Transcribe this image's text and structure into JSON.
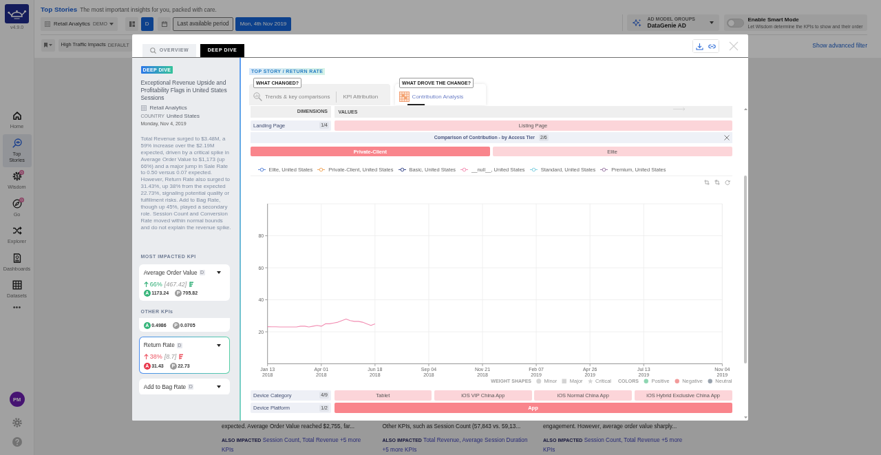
{
  "app": {
    "version": "v4.9.0"
  },
  "sidebar": {
    "items": [
      {
        "label": "Home",
        "selected": false,
        "badge": false
      },
      {
        "label": "Top Stories",
        "selected": true,
        "badge": false
      },
      {
        "label": "Wisdom",
        "selected": false,
        "badge": true
      },
      {
        "label": "Go",
        "selected": false,
        "badge": true
      },
      {
        "label": "Explorer",
        "selected": false,
        "badge": false
      },
      {
        "label": "Dashboards",
        "selected": false,
        "badge": false
      },
      {
        "label": "Datasets",
        "selected": false,
        "badge": false
      }
    ],
    "more": "•••",
    "avatar": "PM"
  },
  "header": {
    "title": "Top Stories",
    "subtitle": "The most important insights for you, packed with care.",
    "dataset": "Retail Analytics",
    "dataset_tag": "DEMO",
    "granularity": "D",
    "period": "Last available period",
    "date": "Mon, 4th Nov 2019",
    "model_group_caption": "AD MODEL GROUPS",
    "model_group": "DataGenie AD",
    "smart_mode": {
      "label": "Enable Smart Mode",
      "hint": "Let Wisdom determine the KPIs to show and their order",
      "on": false
    },
    "view": "High Traffic Impacts",
    "view_tag": "DEFAULT",
    "advanced_filter": "Show advanced filter"
  },
  "story_cards": [
    {
      "text": "expected. Average Order Value reached $2,755, far...",
      "also_label": "ALSO IMPACTED",
      "also": "Session Count, Total Revenue +5 more KPIs"
    },
    {
      "text": "Other KPIs, such as Session Count (57,843 vs. 59,13...",
      "also_label": "ALSO IMPACTED",
      "also": "Total Revenue, Average Session Duration +5 more KPIs"
    },
    {
      "text": "engagement. However, average order value sharply...",
      "also_label": "ALSO IMPACTED",
      "also": "Session Count, Total Revenue +5 more KPIs"
    }
  ],
  "modal": {
    "tabs": [
      {
        "label": "OVERVIEW",
        "selected": false
      },
      {
        "label": "DEEP DIVE",
        "selected": true
      }
    ],
    "story": {
      "badge": "DEEP DIVE",
      "title": "Exceptional Revenue Upside and Profitability Flags in United States Sessions",
      "dataset": "Retail Analytics",
      "country_label": "COUNTRY",
      "country": "United States",
      "date": "Monday, Nov 4, 2019",
      "summary": "Total Revenue surged to $3.48M, a 59% increase over the $2.19M expected, driven by a critical spike in Average Order Value to $1,173 (up 66%) and a major jump in Sale Rate to 0.50 versus 0.07 expected. However, Return Rate also surged to 31.43%, up 38% from the expected 22.73%, signaling potential quality or fulfillment risks. Add to Bag Rate, though up 45%, played a secondary role. Session Count and Conversion Rate moved within normal bounds and do not explain the revenue spike.",
      "most_impacted_label": "MOST IMPACTED KPI",
      "most_impacted": {
        "name": "Average Order Value",
        "tag": "D",
        "positive": true,
        "change": "66%",
        "delta": "[467.42]",
        "actual_letter": "A",
        "actual": "1173.24",
        "predicted_letter": "P",
        "predicted": "705.82",
        "selected": false
      },
      "other_label": "OTHER KPIs",
      "other_kpis": [
        {
          "positive": true,
          "actual_letter": "A",
          "actual": "0.4986",
          "predicted_letter": "P",
          "predicted": "0.0705",
          "selected": false
        },
        {
          "name": "Return Rate",
          "tag": "D",
          "positive": false,
          "change": "38%",
          "delta": "[8.7]",
          "actual_letter": "A",
          "actual": "31.43",
          "predicted_letter": "P",
          "predicted": "22.73",
          "selected": true
        },
        {
          "name": "Add to Bag Rate",
          "tag": "D",
          "selected": false
        }
      ]
    },
    "breadcrumb": "TOP STORY / RETURN RATE",
    "analysis_groups": [
      {
        "caption": "WHAT CHANGED?",
        "tabs": [
          {
            "label": "Trends & key comparisons",
            "selected": false
          },
          {
            "label": "KPI Attribution",
            "selected": false
          }
        ]
      },
      {
        "caption": "WHAT DROVE THE CHANGE?",
        "tabs": [
          {
            "label": "Contribution Analysis",
            "selected": true
          }
        ]
      }
    ],
    "contribution": {
      "dimensions_header": "DIMENSIONS",
      "values_header": "VALUES",
      "rows_above": [
        {
          "dimension": "Landing Page",
          "count": "1/4",
          "values": [
            {
              "label": "Listing Page",
              "selected": false
            }
          ]
        }
      ],
      "comparison": {
        "title": "Comparison of Contribution - by Access Tier",
        "count": "2/6",
        "values": [
          {
            "label": "Private-Client",
            "selected": true
          },
          {
            "label": "Elite",
            "selected": false
          }
        ]
      },
      "chart": {
        "chart_data": {
          "type": "line",
          "grid": true,
          "categories": [
            "Jan 13 2018",
            null,
            null,
            null,
            null,
            null,
            null,
            null,
            null,
            null,
            null,
            null,
            null,
            "Apr 01 2018",
            null,
            null,
            null,
            null,
            null,
            null,
            null,
            null,
            null,
            null,
            null,
            null,
            "Jun 18 2018",
            null,
            null,
            null,
            null,
            null,
            null,
            null,
            null,
            null,
            null,
            null,
            null,
            "Sep 04 2018",
            null,
            null,
            null,
            null,
            null,
            null,
            null,
            null,
            null,
            null,
            null,
            null,
            "Nov 21 2018",
            null,
            null,
            null,
            null,
            null,
            null,
            null,
            null,
            null,
            null,
            null,
            null,
            "Feb 07 2019",
            null,
            null,
            null,
            null,
            null,
            null,
            null,
            null,
            null,
            null,
            null,
            null,
            "Apr 26 2019",
            null,
            null,
            null,
            null,
            null,
            null,
            null,
            null,
            null,
            null,
            null,
            null,
            "Jul 13 2019",
            null,
            null,
            null,
            null,
            null,
            null,
            null,
            null,
            null,
            null,
            null,
            null,
            null,
            null,
            null,
            null,
            null,
            null,
            "Nov 04 2019"
          ],
          "ylim": [
            0,
            100
          ],
          "yticks": [
            20,
            40,
            60,
            80
          ],
          "series": [
            {
              "name": "Elite, United States",
              "color": "#5b86d9",
              "values": [
                null,
                null,
                null,
                null,
                null,
                null,
                null,
                null,
                null,
                null,
                null,
                null,
                null,
                null,
                null,
                null,
                null,
                null,
                null,
                null,
                null,
                null,
                null,
                null,
                null,
                null,
                null,
                null,
                null,
                null,
                null,
                null,
                null,
                null,
                null,
                null,
                null,
                null,
                null,
                null,
                null,
                null,
                null,
                null,
                null,
                null,
                null,
                null,
                null,
                null,
                null,
                null,
                null,
                null,
                null,
                null,
                null,
                null,
                null,
                null,
                null,
                null,
                null,
                null,
                null,
                null,
                null,
                null,
                null,
                null,
                null,
                null,
                null,
                null,
                null,
                null,
                null,
                null,
                null,
                null,
                null,
                null,
                null,
                null,
                null,
                null,
                null,
                null,
                null,
                null,
                null,
                null,
                null,
                null,
                null,
                null,
                null,
                null,
                null,
                null,
                null,
                null,
                null,
                null,
                null,
                null,
                null,
                null,
                null,
                null,
                null
              ]
            },
            {
              "name": "Private-Client, United States",
              "color": "#f0a55a",
              "values": [
                null,
                null,
                null,
                null,
                null,
                null,
                null,
                null,
                null,
                null,
                null,
                null,
                null,
                null,
                null,
                null,
                null,
                null,
                null,
                null,
                null,
                null,
                null,
                null,
                null,
                null,
                null,
                null,
                null,
                null,
                null,
                null,
                null,
                null,
                null,
                null,
                null,
                null,
                null,
                null,
                null,
                null,
                null,
                null,
                null,
                null,
                null,
                null,
                null,
                null,
                null,
                null,
                null,
                null,
                null,
                null,
                null,
                null,
                null,
                null,
                null,
                null,
                null,
                null,
                null,
                null,
                null,
                null,
                null,
                null,
                null,
                null,
                null,
                null,
                null,
                null,
                null,
                null,
                null,
                null,
                null,
                null,
                null,
                null,
                null,
                null,
                null,
                null,
                null,
                null,
                null,
                null,
                null,
                null,
                null,
                null,
                null,
                null,
                null,
                null,
                null,
                null,
                null,
                null,
                null,
                null,
                null,
                null,
                null,
                null,
                null
              ]
            },
            {
              "name": "Basic, United States",
              "color": "#3b4a8c",
              "values": [
                null,
                null,
                null,
                null,
                null,
                null,
                null,
                null,
                null,
                null,
                null,
                null,
                null,
                null,
                null,
                null,
                null,
                null,
                null,
                null,
                null,
                null,
                null,
                null,
                null,
                null,
                null,
                null,
                null,
                null,
                null,
                null,
                null,
                null,
                null,
                null,
                null,
                null,
                null,
                null,
                null,
                null,
                null,
                null,
                null,
                null,
                null,
                null,
                null,
                null,
                null,
                null,
                null,
                null,
                null,
                null,
                null,
                null,
                null,
                null,
                null,
                null,
                null,
                null,
                null,
                null,
                null,
                null,
                null,
                null,
                null,
                null,
                null,
                null,
                null,
                null,
                null,
                null,
                null,
                null,
                null,
                null,
                null,
                null,
                null,
                null,
                null,
                null,
                null,
                null,
                null,
                null,
                null,
                null,
                null,
                null,
                null,
                null,
                null,
                null,
                null,
                null,
                null,
                null,
                null,
                null,
                null,
                null,
                null,
                null,
                null
              ]
            },
            {
              "name": "__null__, United States",
              "color": "#f28db2",
              "values": [
                23.2,
                23.1,
                23.1,
                23,
                23,
                23,
                23,
                23,
                23.5,
                23.5,
                23,
                23.5,
                24,
                23.5,
                25,
                25,
                25.5,
                26,
                27,
                28,
                27,
                26.5,
                26.5,
                26,
                25,
                24,
                25,
                null,
                null,
                null,
                null,
                null,
                null,
                null,
                null,
                null,
                null,
                null,
                null,
                null,
                null,
                null,
                null,
                null,
                null,
                null,
                null,
                null,
                null,
                null,
                null,
                null,
                null,
                null,
                null,
                null,
                null,
                null,
                null,
                null,
                null,
                null,
                null,
                null,
                null,
                null,
                null,
                null,
                null,
                null,
                null,
                null,
                null,
                null,
                null,
                null,
                null,
                null,
                null,
                null,
                null,
                null,
                null,
                null,
                null,
                null,
                null,
                null,
                null,
                null,
                null,
                null,
                null,
                null,
                null,
                null,
                null,
                null,
                null,
                null,
                null,
                null,
                null,
                null,
                null,
                null,
                null,
                null,
                null,
                null,
                null
              ]
            },
            {
              "name": "Standard, United States",
              "color": "#7fd0e0",
              "values": [
                null,
                null,
                null,
                null,
                null,
                null,
                null,
                null,
                null,
                null,
                null,
                null,
                null,
                null,
                null,
                null,
                null,
                null,
                null,
                null,
                null,
                null,
                null,
                null,
                null,
                null,
                null,
                null,
                null,
                null,
                null,
                null,
                null,
                null,
                null,
                null,
                null,
                null,
                null,
                null,
                null,
                null,
                null,
                null,
                null,
                null,
                null,
                null,
                null,
                null,
                null,
                null,
                null,
                null,
                null,
                null,
                null,
                null,
                null,
                null,
                null,
                null,
                null,
                null,
                null,
                null,
                null,
                null,
                null,
                null,
                null,
                null,
                null,
                null,
                null,
                null,
                null,
                null,
                null,
                null,
                null,
                null,
                null,
                null,
                null,
                null,
                null,
                null,
                null,
                null,
                null,
                null,
                null,
                null,
                null,
                null,
                null,
                null,
                null,
                null,
                null,
                null,
                null,
                null,
                null,
                null,
                null,
                null,
                null,
                null,
                null
              ]
            },
            {
              "name": "Premium, United States",
              "color": "#9c7aa6",
              "values": [
                null,
                null,
                null,
                null,
                null,
                null,
                null,
                null,
                null,
                null,
                null,
                null,
                null,
                null,
                null,
                null,
                null,
                null,
                null,
                null,
                null,
                null,
                null,
                null,
                null,
                null,
                null,
                null,
                null,
                null,
                null,
                null,
                null,
                null,
                null,
                null,
                null,
                null,
                null,
                null,
                null,
                null,
                null,
                null,
                null,
                null,
                null,
                null,
                null,
                null,
                null,
                null,
                null,
                null,
                null,
                null,
                null,
                null,
                null,
                null,
                null,
                null,
                null,
                null,
                null,
                null,
                null,
                null,
                null,
                null,
                null,
                null,
                null,
                null,
                null,
                null,
                null,
                null,
                null,
                null,
                null,
                null,
                null,
                null,
                null,
                null,
                null,
                null,
                null,
                null,
                null,
                null,
                null,
                null,
                null,
                null,
                null,
                null,
                null,
                null,
                null,
                null,
                null,
                null,
                null,
                null,
                null,
                null,
                null,
                null,
                null
              ]
            }
          ]
        }
      },
      "weight_legend": {
        "shapes_label": "WEIGHT SHAPES",
        "shapes": [
          {
            "kind": "circle",
            "label": "Minor"
          },
          {
            "kind": "square",
            "label": "Major"
          },
          {
            "kind": "star",
            "label": "Critical"
          }
        ],
        "colors_label": "COLORS",
        "colors": [
          {
            "label": "Positive",
            "color": "#8fd6b2"
          },
          {
            "label": "Negative",
            "color": "#f29a9a"
          },
          {
            "label": "Neutral",
            "color": "#98a2ad"
          }
        ]
      },
      "rows_below": [
        {
          "dimension": "Device Category",
          "count": "4/9",
          "values": [
            {
              "label": "Tablet",
              "selected": false
            },
            {
              "label": "iOS VIP China App",
              "selected": false
            },
            {
              "label": "iOS Normal China App",
              "selected": false
            },
            {
              "label": "iOS Hybrid Exclusive China App",
              "selected": false
            }
          ]
        },
        {
          "dimension": "Device Platform",
          "count": "1/2",
          "values": [
            {
              "label": "App",
              "selected": true
            }
          ]
        }
      ]
    }
  }
}
